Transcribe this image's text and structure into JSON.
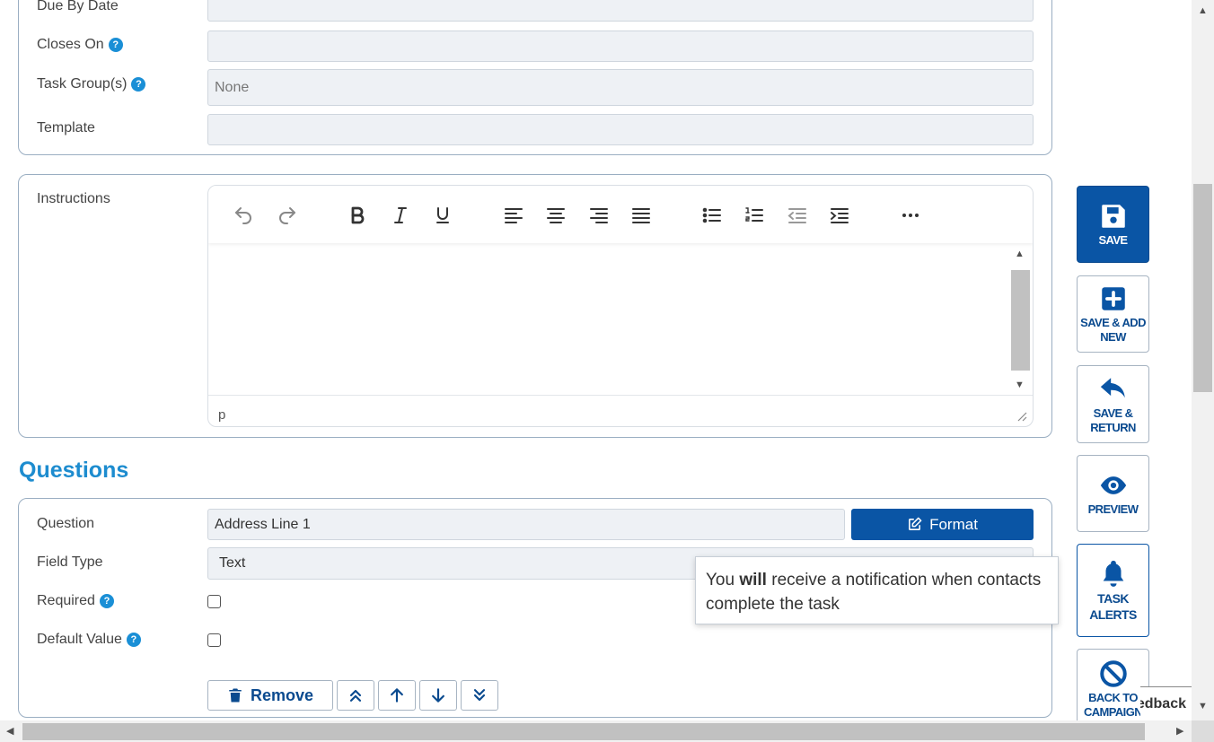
{
  "top_panel": {
    "fields": [
      {
        "label": "Due By Date",
        "value": "",
        "help": false
      },
      {
        "label": "Closes On",
        "value": "",
        "help": true
      },
      {
        "label": "Task Group(s)",
        "value": "",
        "placeholder": "None",
        "help": true
      },
      {
        "label": "Template",
        "value": "",
        "help": false
      }
    ]
  },
  "instructions": {
    "label": "Instructions",
    "toolbar": [
      "undo-icon",
      "redo-icon",
      "bold-icon",
      "italic-icon",
      "underline-icon",
      "align-left-icon",
      "align-center-icon",
      "align-right-icon",
      "align-justify-icon",
      "bullet-list-icon",
      "numbered-list-icon",
      "outdent-icon",
      "indent-icon",
      "more-icon"
    ],
    "status_path": "p"
  },
  "questions": {
    "title": "Questions",
    "question_label": "Question",
    "question_value": "Address Line 1",
    "format_button": "Format",
    "field_type_label": "Field Type",
    "field_type_value": "Text",
    "required_label": "Required",
    "default_value_label": "Default Value",
    "remove_button": "Remove"
  },
  "tooltip": {
    "prefix": "You ",
    "bold": "will",
    "suffix": " receive a notification when contacts complete the task"
  },
  "actions": {
    "save": "SAVE",
    "save_add_new": "SAVE & ADD\nNEW",
    "save_return": "SAVE &\nRETURN",
    "preview": "PREVIEW",
    "task_alerts": "TASK\nALERTS",
    "back_to_campaign": "BACK TO\nCAMPAIGN"
  },
  "feedback": "Feedback",
  "colors": {
    "accent": "#0a55a5",
    "heading": "#1d8ccf",
    "help": "#1a8fd6",
    "field_bg": "#eef1f5"
  }
}
